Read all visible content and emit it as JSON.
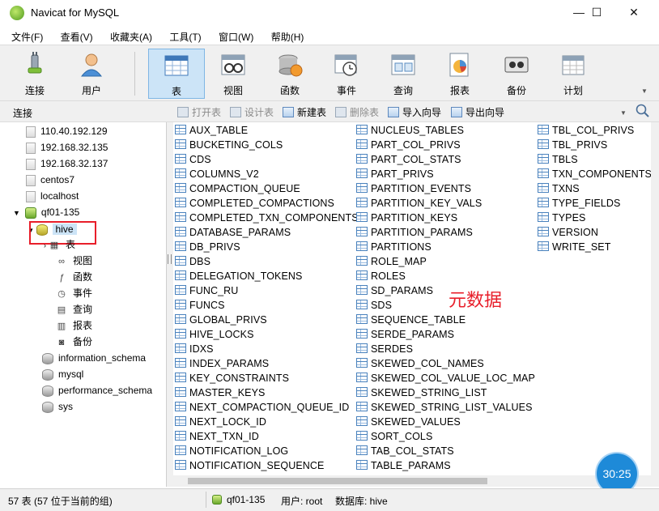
{
  "window": {
    "title": "Navicat for MySQL",
    "minimize": "—",
    "maximize": "☐",
    "close": "✕"
  },
  "menu": [
    "文件(F)",
    "查看(V)",
    "收藏夹(A)",
    "工具(T)",
    "窗口(W)",
    "帮助(H)"
  ],
  "toolbar": [
    {
      "label": "连接",
      "icon": "plug-icon"
    },
    {
      "label": "用户",
      "icon": "user-icon"
    },
    {
      "label": "表",
      "icon": "table-icon",
      "active": true
    },
    {
      "label": "视图",
      "icon": "view-icon"
    },
    {
      "label": "函数",
      "icon": "function-icon"
    },
    {
      "label": "事件",
      "icon": "event-icon"
    },
    {
      "label": "查询",
      "icon": "query-icon"
    },
    {
      "label": "报表",
      "icon": "report-icon"
    },
    {
      "label": "备份",
      "icon": "backup-icon"
    },
    {
      "label": "计划",
      "icon": "schedule-icon"
    }
  ],
  "subbar": {
    "connection_label": "连接",
    "actions": [
      {
        "label": "打开表",
        "enabled": false
      },
      {
        "label": "设计表",
        "enabled": false
      },
      {
        "label": "新建表",
        "enabled": true
      },
      {
        "label": "删除表",
        "enabled": false
      },
      {
        "label": "导入向导",
        "enabled": true
      },
      {
        "label": "导出向导",
        "enabled": true
      }
    ]
  },
  "tree": {
    "servers": [
      "110.40.192.129",
      "192.168.32.135",
      "192.168.32.137",
      "centos7",
      "localhost"
    ],
    "connection": "qf01-135",
    "selected_db": "hive",
    "hive_children": [
      "表",
      "视图",
      "函数",
      "事件",
      "查询",
      "报表",
      "备份"
    ],
    "other_dbs": [
      "information_schema",
      "mysql",
      "performance_schema",
      "sys"
    ]
  },
  "tables": {
    "col1": [
      "AUX_TABLE",
      "BUCKETING_COLS",
      "CDS",
      "COLUMNS_V2",
      "COMPACTION_QUEUE",
      "COMPLETED_COMPACTIONS",
      "COMPLETED_TXN_COMPONENTS",
      "DATABASE_PARAMS",
      "DB_PRIVS",
      "DBS",
      "DELEGATION_TOKENS",
      "FUNC_RU",
      "FUNCS",
      "GLOBAL_PRIVS",
      "HIVE_LOCKS",
      "IDXS",
      "INDEX_PARAMS",
      "KEY_CONSTRAINTS",
      "MASTER_KEYS",
      "NEXT_COMPACTION_QUEUE_ID",
      "NEXT_LOCK_ID",
      "NEXT_TXN_ID",
      "NOTIFICATION_LOG",
      "NOTIFICATION_SEQUENCE"
    ],
    "col2": [
      "NUCLEUS_TABLES",
      "PART_COL_PRIVS",
      "PART_COL_STATS",
      "PART_PRIVS",
      "PARTITION_EVENTS",
      "PARTITION_KEY_VALS",
      "PARTITION_KEYS",
      "PARTITION_PARAMS",
      "PARTITIONS",
      "ROLE_MAP",
      "ROLES",
      "SD_PARAMS",
      "SDS",
      "SEQUENCE_TABLE",
      "SERDE_PARAMS",
      "SERDES",
      "SKEWED_COL_NAMES",
      "SKEWED_COL_VALUE_LOC_MAP",
      "SKEWED_STRING_LIST",
      "SKEWED_STRING_LIST_VALUES",
      "SKEWED_VALUES",
      "SORT_COLS",
      "TAB_COL_STATS",
      "TABLE_PARAMS"
    ],
    "col3": [
      "TBL_COL_PRIVS",
      "TBL_PRIVS",
      "TBLS",
      "TXN_COMPONENTS",
      "TXNS",
      "TYPE_FIELDS",
      "TYPES",
      "VERSION",
      "WRITE_SET"
    ]
  },
  "annotation": "元数据",
  "timer": "30:25",
  "status": {
    "count": "57 表 (57 位于当前的组)",
    "connection": "qf01-135",
    "user": "用户: root",
    "database": "数据库: hive"
  }
}
